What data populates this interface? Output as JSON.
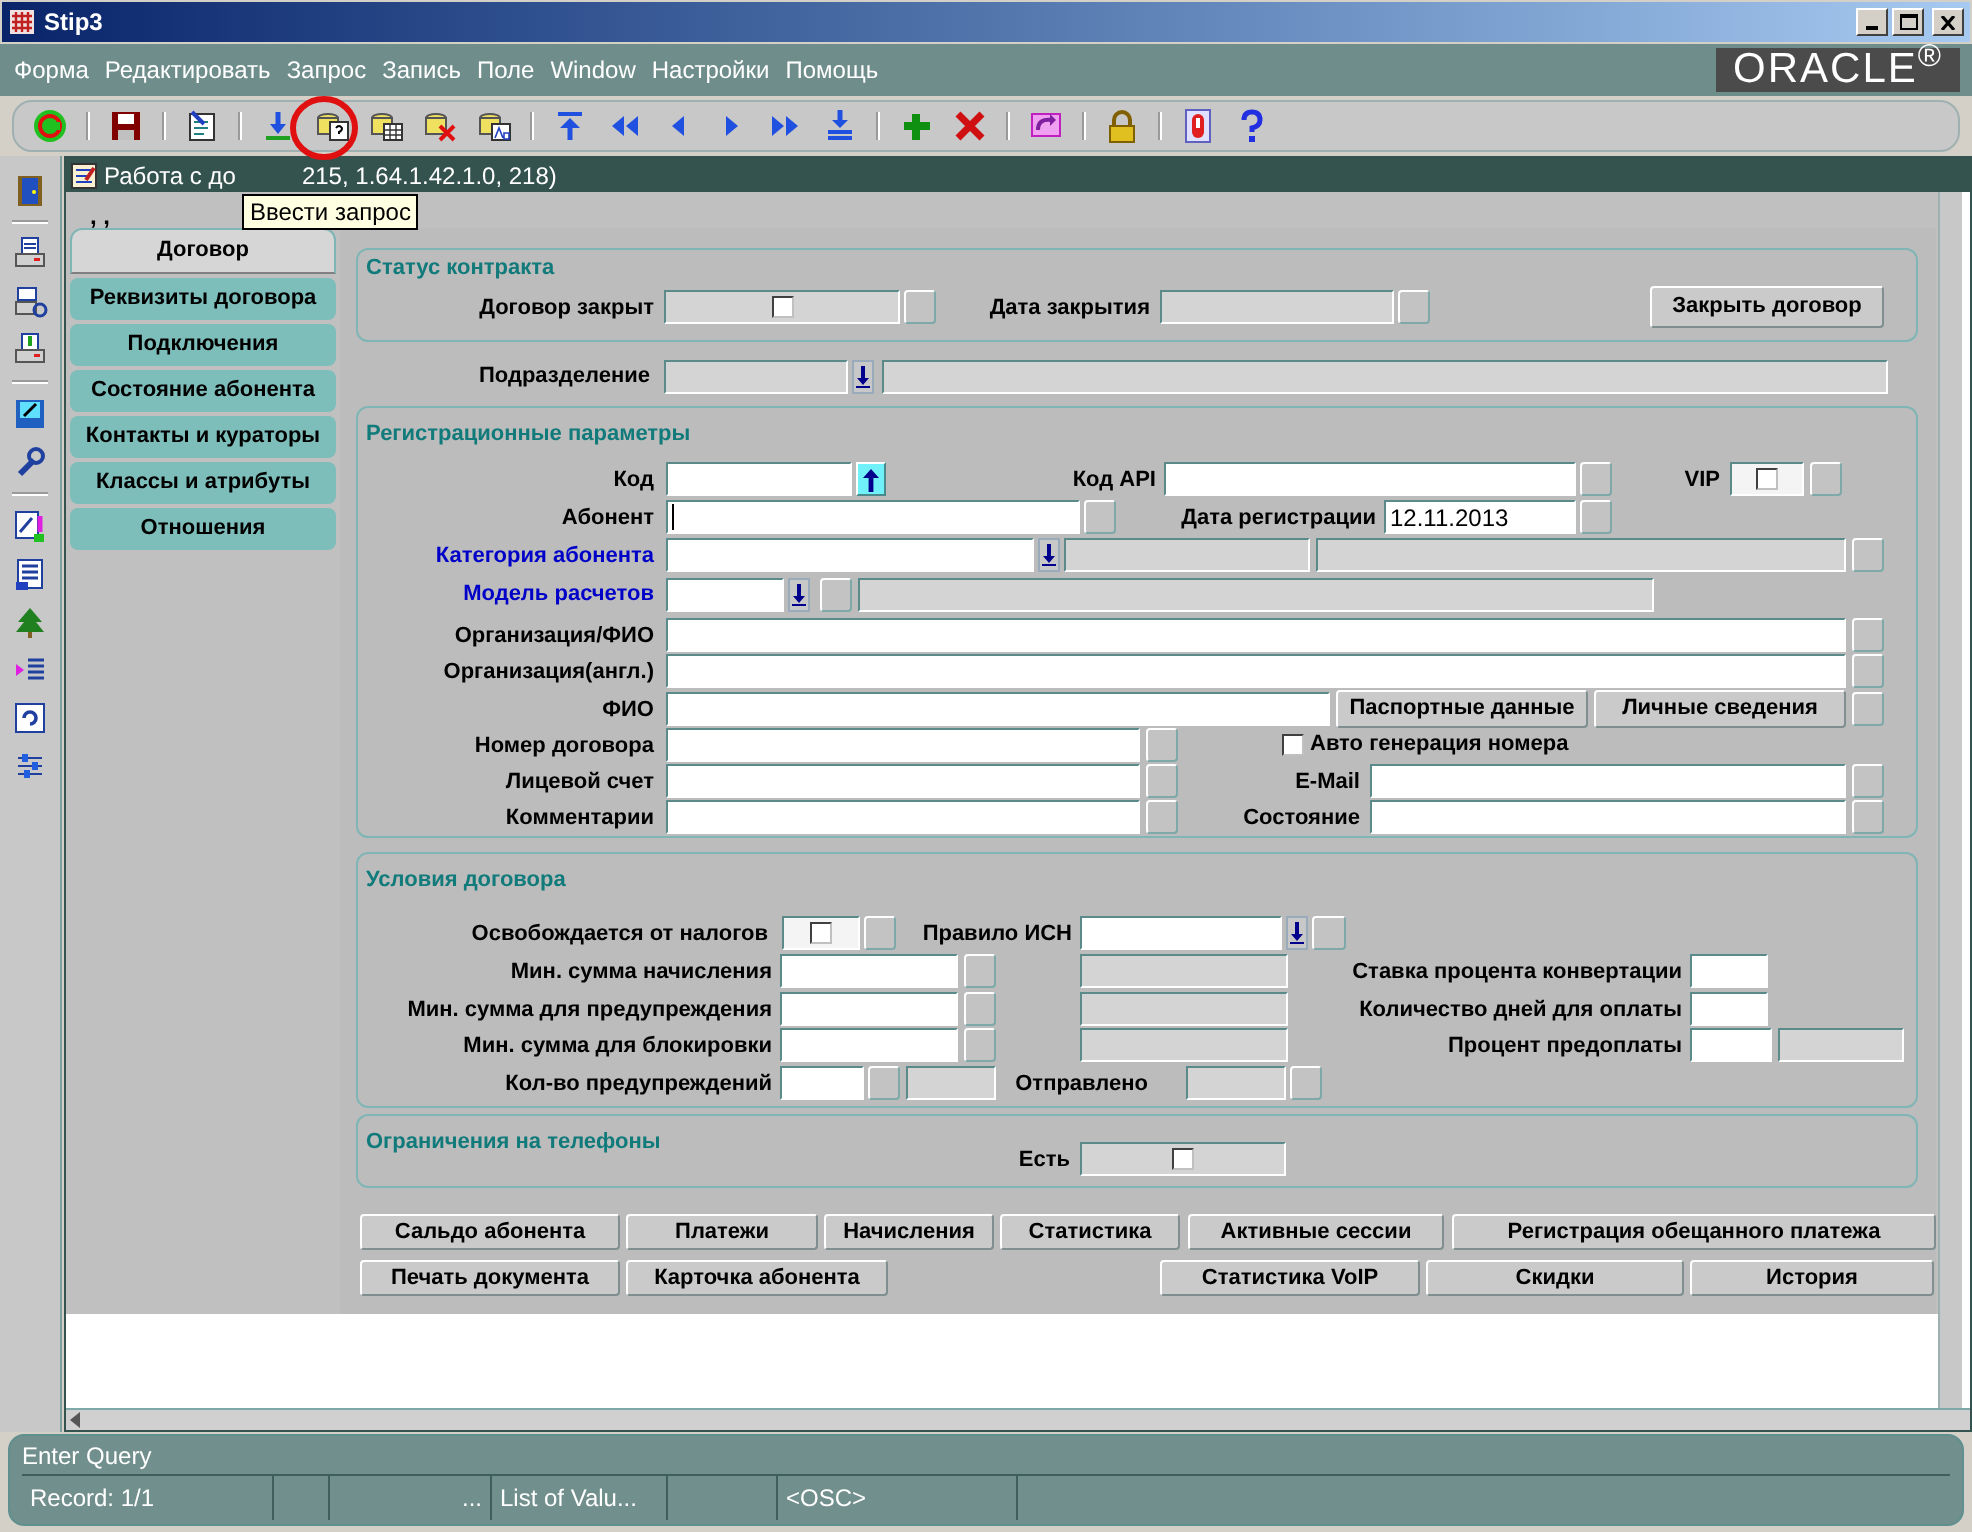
{
  "window": {
    "title": "Stip3"
  },
  "menu": [
    "Форма",
    "Редактировать",
    "Запрос",
    "Запись",
    "Поле",
    "Window",
    "Настройки",
    "Помощь"
  ],
  "logo": "ORACLE$^{®}$",
  "tooltip": "Ввести запрос",
  "form_window": {
    "title_start": "Работа с до",
    "title_end": "215, 1.64.1.42.1.0, 218)",
    "record_marker": ", ,"
  },
  "tabs": [
    {
      "label": "Договор",
      "selected": true
    },
    {
      "label": "Реквизиты договора",
      "selected": false
    },
    {
      "label": "Подключения",
      "selected": false
    },
    {
      "label": "Состояние абонента",
      "selected": false
    },
    {
      "label": "Контакты и кураторы",
      "selected": false
    },
    {
      "label": "Классы и атрибуты",
      "selected": false
    },
    {
      "label": "Отношения",
      "selected": false
    }
  ],
  "sections": [
    {
      "title": "Статус контракта",
      "rows": [
        {
          "items": [
            {
              "kind": "label",
              "text": "Договор закрыт"
            },
            {
              "kind": "checkfield",
              "editable": false,
              "checked": false
            },
            {
              "kind": "square"
            },
            {
              "kind": "label",
              "text": "Дата закрытия"
            },
            {
              "kind": "field",
              "editable": false
            },
            {
              "kind": "square"
            },
            {
              "kind": "button",
              "label": "Закрыть договор"
            }
          ]
        }
      ]
    },
    {
      "rows": [
        {
          "items": [
            {
              "kind": "label",
              "text": "Подразделение"
            },
            {
              "kind": "field",
              "editable": false
            },
            {
              "kind": "lov"
            },
            {
              "kind": "field",
              "editable": false
            }
          ]
        }
      ]
    },
    {
      "title": "Регистрационные параметры",
      "rows": [
        {
          "items": [
            {
              "kind": "label",
              "text": "Код"
            },
            {
              "kind": "field",
              "editable": true
            },
            {
              "kind": "up"
            },
            {
              "kind": "label",
              "text": "Код API"
            },
            {
              "kind": "field",
              "editable": true
            },
            {
              "kind": "square"
            },
            {
              "kind": "label",
              "text": "VIP"
            },
            {
              "kind": "checkfield",
              "editable": true,
              "checked": false
            },
            {
              "kind": "square"
            }
          ]
        },
        {
          "items": [
            {
              "kind": "label",
              "text": "Абонент"
            },
            {
              "kind": "field",
              "editable": true,
              "focused": true
            },
            {
              "kind": "square"
            },
            {
              "kind": "label",
              "text": "Дата регистрации"
            },
            {
              "kind": "field",
              "editable": true,
              "value": "12.11.2013"
            },
            {
              "kind": "square"
            }
          ]
        },
        {
          "items": [
            {
              "kind": "label",
              "text": "Категория абонента",
              "required": true
            },
            {
              "kind": "field",
              "editable": true
            },
            {
              "kind": "lov"
            },
            {
              "kind": "field",
              "editable": false
            },
            {
              "kind": "field",
              "editable": false
            },
            {
              "kind": "square"
            }
          ]
        },
        {
          "items": [
            {
              "kind": "label",
              "text": "Модель расчетов",
              "required": true
            },
            {
              "kind": "field",
              "editable": true
            },
            {
              "kind": "lov"
            },
            {
              "kind": "square"
            },
            {
              "kind": "field",
              "editable": false
            }
          ]
        },
        {
          "items": [
            {
              "kind": "label",
              "text": "Организация/ФИО"
            },
            {
              "kind": "field",
              "editable": true
            },
            {
              "kind": "square"
            }
          ]
        },
        {
          "items": [
            {
              "kind": "label",
              "text": "Организация(англ.)"
            },
            {
              "kind": "field",
              "editable": true
            },
            {
              "kind": "square"
            }
          ]
        },
        {
          "items": [
            {
              "kind": "label",
              "text": "ФИО"
            },
            {
              "kind": "field",
              "editable": true
            },
            {
              "kind": "button",
              "label": "Паспортные данные"
            },
            {
              "kind": "button",
              "label": "Личные сведения"
            },
            {
              "kind": "square"
            }
          ]
        },
        {
          "items": [
            {
              "kind": "label",
              "text": "Номер договора"
            },
            {
              "kind": "field",
              "editable": true
            },
            {
              "kind": "square"
            },
            {
              "kind": "checkbox",
              "label": "Авто генерация номера",
              "checked": false
            }
          ]
        },
        {
          "items": [
            {
              "kind": "label",
              "text": "Лицевой счет"
            },
            {
              "kind": "field",
              "editable": true
            },
            {
              "kind": "square"
            },
            {
              "kind": "label",
              "text": "E-Mail"
            },
            {
              "kind": "field",
              "editable": true
            },
            {
              "kind": "square"
            }
          ]
        },
        {
          "items": [
            {
              "kind": "label",
              "text": "Комментарии"
            },
            {
              "kind": "field",
              "editable": true
            },
            {
              "kind": "square"
            },
            {
              "kind": "label",
              "text": "Состояние"
            },
            {
              "kind": "field",
              "editable": true
            },
            {
              "kind": "square"
            }
          ]
        }
      ]
    },
    {
      "title": "Условия договора",
      "rows": [
        {
          "items": [
            {
              "kind": "label",
              "text": "Освобождается от налогов"
            },
            {
              "kind": "checkfield",
              "editable": true,
              "checked": false
            },
            {
              "kind": "square"
            },
            {
              "kind": "label",
              "text": "Правило ИСН"
            },
            {
              "kind": "field",
              "editable": true
            },
            {
              "kind": "lov"
            },
            {
              "kind": "square"
            }
          ]
        },
        {
          "items": [
            {
              "kind": "label",
              "text": "Мин. сумма начисления"
            },
            {
              "kind": "field",
              "editable": true
            },
            {
              "kind": "square"
            },
            {
              "kind": "field",
              "editable": false
            },
            {
              "kind": "label",
              "text": "Ставка процента конвертации"
            },
            {
              "kind": "field",
              "editable": true
            }
          ]
        },
        {
          "items": [
            {
              "kind": "label",
              "text": "Мин. сумма для предупреждения"
            },
            {
              "kind": "field",
              "editable": true
            },
            {
              "kind": "square"
            },
            {
              "kind": "field",
              "editable": false
            },
            {
              "kind": "label",
              "text": "Количество дней для оплаты"
            },
            {
              "kind": "field",
              "editable": true
            }
          ]
        },
        {
          "items": [
            {
              "kind": "label",
              "text": "Мин. сумма для блокировки"
            },
            {
              "kind": "field",
              "editable": true
            },
            {
              "kind": "square"
            },
            {
              "kind": "field",
              "editable": false
            },
            {
              "kind": "label",
              "text": "Процент предоплаты"
            },
            {
              "kind": "field",
              "editable": true
            },
            {
              "kind": "field",
              "editable": false
            }
          ]
        },
        {
          "items": [
            {
              "kind": "label",
              "text": "Кол-во предупреждений"
            },
            {
              "kind": "field",
              "editable": true
            },
            {
              "kind": "square"
            },
            {
              "kind": "field",
              "editable": false
            },
            {
              "kind": "label",
              "text": "Отправлено"
            },
            {
              "kind": "field",
              "editable": false
            },
            {
              "kind": "square"
            }
          ]
        }
      ]
    },
    {
      "title": "Ограничения на телефоны",
      "rows": [
        {
          "items": [
            {
              "kind": "label",
              "text": "Есть"
            },
            {
              "kind": "checkfield",
              "editable": false,
              "checked": false
            }
          ]
        }
      ]
    },
    {
      "rows": [
        {
          "items": [
            {
              "kind": "button",
              "label": "Сальдо абонента"
            },
            {
              "kind": "button",
              "label": "Платежи"
            },
            {
              "kind": "button",
              "label": "Начисления"
            },
            {
              "kind": "button",
              "label": "Статистика"
            },
            {
              "kind": "button",
              "label": "Активные сессии"
            },
            {
              "kind": "button",
              "label": "Регистрация обещанного платежа"
            }
          ]
        },
        {
          "items": [
            {
              "kind": "button",
              "label": "Печать документа"
            },
            {
              "kind": "button",
              "label": "Карточка абонента"
            },
            {
              "kind": "button",
              "label": "Статистика VoIP"
            },
            {
              "kind": "button",
              "label": "Скидки"
            },
            {
              "kind": "button",
              "label": "История"
            }
          ]
        }
      ]
    }
  ],
  "status_bar": {
    "message": "Enter Query",
    "cells": [
      "Record: 1/1",
      "",
      "...",
      "List of Valu...",
      "",
      "<OSC>"
    ]
  }
}
